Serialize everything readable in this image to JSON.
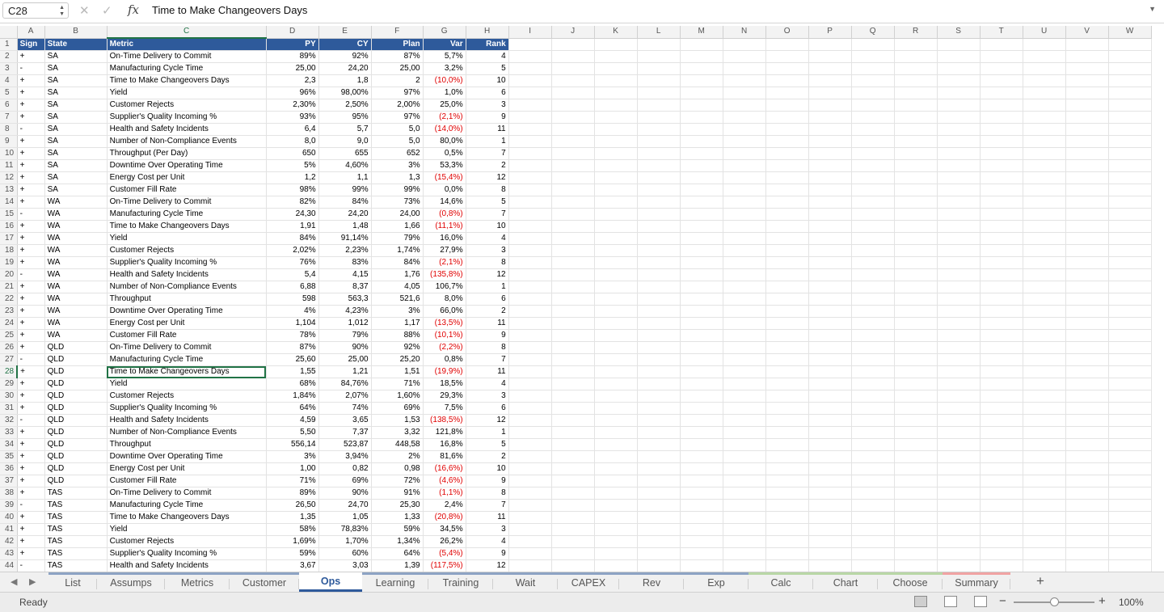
{
  "formula_bar": {
    "name_box": "C28",
    "formula": "Time to Make Changeovers Days",
    "fx_label": "fx"
  },
  "grid": {
    "columns": [
      "A",
      "B",
      "C",
      "D",
      "E",
      "F",
      "G",
      "H",
      "I",
      "J",
      "K",
      "L",
      "M",
      "N",
      "O",
      "P",
      "Q",
      "R",
      "S",
      "T",
      "U",
      "V",
      "W"
    ],
    "selected_column": "C",
    "selected_row": 28,
    "header_row": [
      "Sign",
      "State",
      "Metric",
      "PY",
      "CY",
      "Plan",
      "Var",
      "Rank"
    ],
    "rows": [
      [
        "+",
        "SA",
        "On-Time Delivery to Commit",
        "89%",
        "92%",
        "87%",
        "5,7%",
        "4"
      ],
      [
        "-",
        "SA",
        "Manufacturing Cycle Time",
        "25,00",
        "24,20",
        "25,00",
        "3,2%",
        "5"
      ],
      [
        "+",
        "SA",
        "Time to Make Changeovers Days",
        "2,3",
        "1,8",
        "2",
        "(10,0%)",
        "10"
      ],
      [
        "+",
        "SA",
        "Yield",
        "96%",
        "98,00%",
        "97%",
        "1,0%",
        "6"
      ],
      [
        "+",
        "SA",
        "Customer Rejects",
        "2,30%",
        "2,50%",
        "2,00%",
        "25,0%",
        "3"
      ],
      [
        "+",
        "SA",
        "Supplier's Quality Incoming %",
        "93%",
        "95%",
        "97%",
        "(2,1%)",
        "9"
      ],
      [
        "-",
        "SA",
        "Health and Safety Incidents",
        "6,4",
        "5,7",
        "5,0",
        "(14,0%)",
        "11"
      ],
      [
        "+",
        "SA",
        "Number of Non-Compliance Events",
        "8,0",
        "9,0",
        "5,0",
        "80,0%",
        "1"
      ],
      [
        "+",
        "SA",
        "Throughput (Per Day)",
        "650",
        "655",
        "652",
        "0,5%",
        "7"
      ],
      [
        "+",
        "SA",
        "Downtime Over Operating Time",
        "5%",
        "4,60%",
        "3%",
        "53,3%",
        "2"
      ],
      [
        "+",
        "SA",
        "Energy Cost per Unit",
        "1,2",
        "1,1",
        "1,3",
        "(15,4%)",
        "12"
      ],
      [
        "+",
        "SA",
        "Customer Fill Rate",
        "98%",
        "99%",
        "99%",
        "0,0%",
        "8"
      ],
      [
        "+",
        "WA",
        "On-Time Delivery to Commit",
        "82%",
        "84%",
        "73%",
        "14,6%",
        "5"
      ],
      [
        "-",
        "WA",
        "Manufacturing Cycle Time",
        "24,30",
        "24,20",
        "24,00",
        "(0,8%)",
        "7"
      ],
      [
        "+",
        "WA",
        "Time to Make Changeovers Days",
        "1,91",
        "1,48",
        "1,66",
        "(11,1%)",
        "10"
      ],
      [
        "+",
        "WA",
        "Yield",
        "84%",
        "91,14%",
        "79%",
        "16,0%",
        "4"
      ],
      [
        "+",
        "WA",
        "Customer Rejects",
        "2,02%",
        "2,23%",
        "1,74%",
        "27,9%",
        "3"
      ],
      [
        "+",
        "WA",
        "Supplier's Quality Incoming %",
        "76%",
        "83%",
        "84%",
        "(2,1%)",
        "8"
      ],
      [
        "-",
        "WA",
        "Health and Safety Incidents",
        "5,4",
        "4,15",
        "1,76",
        "(135,8%)",
        "12"
      ],
      [
        "+",
        "WA",
        "Number of Non-Compliance Events",
        "6,88",
        "8,37",
        "4,05",
        "106,7%",
        "1"
      ],
      [
        "+",
        "WA",
        "Throughput",
        "598",
        "563,3",
        "521,6",
        "8,0%",
        "6"
      ],
      [
        "+",
        "WA",
        "Downtime Over Operating Time",
        "4%",
        "4,23%",
        "3%",
        "66,0%",
        "2"
      ],
      [
        "+",
        "WA",
        "Energy Cost per Unit",
        "1,104",
        "1,012",
        "1,17",
        "(13,5%)",
        "11"
      ],
      [
        "+",
        "WA",
        "Customer Fill Rate",
        "78%",
        "79%",
        "88%",
        "(10,1%)",
        "9"
      ],
      [
        "+",
        "QLD",
        "On-Time Delivery to Commit",
        "87%",
        "90%",
        "92%",
        "(2,2%)",
        "8"
      ],
      [
        "-",
        "QLD",
        "Manufacturing Cycle Time",
        "25,60",
        "25,00",
        "25,20",
        "0,8%",
        "7"
      ],
      [
        "+",
        "QLD",
        "Time to Make Changeovers Days",
        "1,55",
        "1,21",
        "1,51",
        "(19,9%)",
        "11"
      ],
      [
        "+",
        "QLD",
        "Yield",
        "68%",
        "84,76%",
        "71%",
        "18,5%",
        "4"
      ],
      [
        "+",
        "QLD",
        "Customer Rejects",
        "1,84%",
        "2,07%",
        "1,60%",
        "29,3%",
        "3"
      ],
      [
        "+",
        "QLD",
        "Supplier's Quality Incoming %",
        "64%",
        "74%",
        "69%",
        "7,5%",
        "6"
      ],
      [
        "-",
        "QLD",
        "Health and Safety Incidents",
        "4,59",
        "3,65",
        "1,53",
        "(138,5%)",
        "12"
      ],
      [
        "+",
        "QLD",
        "Number of Non-Compliance Events",
        "5,50",
        "7,37",
        "3,32",
        "121,8%",
        "1"
      ],
      [
        "+",
        "QLD",
        "Throughput",
        "556,14",
        "523,87",
        "448,58",
        "16,8%",
        "5"
      ],
      [
        "+",
        "QLD",
        "Downtime Over Operating Time",
        "3%",
        "3,94%",
        "2%",
        "81,6%",
        "2"
      ],
      [
        "+",
        "QLD",
        "Energy Cost per Unit",
        "1,00",
        "0,82",
        "0,98",
        "(16,6%)",
        "10"
      ],
      [
        "+",
        "QLD",
        "Customer Fill Rate",
        "71%",
        "69%",
        "72%",
        "(4,6%)",
        "9"
      ],
      [
        "+",
        "TAS",
        "On-Time Delivery to Commit",
        "89%",
        "90%",
        "91%",
        "(1,1%)",
        "8"
      ],
      [
        "-",
        "TAS",
        "Manufacturing Cycle Time",
        "26,50",
        "24,70",
        "25,30",
        "2,4%",
        "7"
      ],
      [
        "+",
        "TAS",
        "Time to Make Changeovers Days",
        "1,35",
        "1,05",
        "1,33",
        "(20,8%)",
        "11"
      ],
      [
        "+",
        "TAS",
        "Yield",
        "58%",
        "78,83%",
        "59%",
        "34,5%",
        "3"
      ],
      [
        "+",
        "TAS",
        "Customer Rejects",
        "1,69%",
        "1,70%",
        "1,34%",
        "26,2%",
        "4"
      ],
      [
        "+",
        "TAS",
        "Supplier's Quality Incoming %",
        "59%",
        "60%",
        "64%",
        "(5,4%)",
        "9"
      ],
      [
        "-",
        "TAS",
        "Health and Safety Incidents",
        "3,67",
        "3,03",
        "1,39",
        "(117,5%)",
        "12"
      ]
    ]
  },
  "sheet_tabs": [
    {
      "label": "List",
      "color": "blue",
      "active": false
    },
    {
      "label": "Assumps",
      "color": "blue",
      "active": false
    },
    {
      "label": "Metrics",
      "color": "blue",
      "active": false
    },
    {
      "label": "Customer",
      "color": "blue",
      "active": false
    },
    {
      "label": "Ops",
      "color": "blue",
      "active": true
    },
    {
      "label": "Learning",
      "color": "blue",
      "active": false
    },
    {
      "label": "Training",
      "color": "blue",
      "active": false
    },
    {
      "label": "Wait",
      "color": "blue",
      "active": false
    },
    {
      "label": "CAPEX",
      "color": "blue",
      "active": false
    },
    {
      "label": "Rev",
      "color": "blue",
      "active": false
    },
    {
      "label": "Exp",
      "color": "blue",
      "active": false
    },
    {
      "label": "Calc",
      "color": "green",
      "active": false
    },
    {
      "label": "Chart",
      "color": "green",
      "active": false
    },
    {
      "label": "Choose",
      "color": "green",
      "active": false
    },
    {
      "label": "Summary",
      "color": "red",
      "active": false
    }
  ],
  "status_bar": {
    "status": "Ready",
    "zoom_level": "100%",
    "zoom_fraction": 0.5
  },
  "colors": {
    "header_fill": "#2e5a9b",
    "negative": "#e00000",
    "selection": "#217346"
  }
}
